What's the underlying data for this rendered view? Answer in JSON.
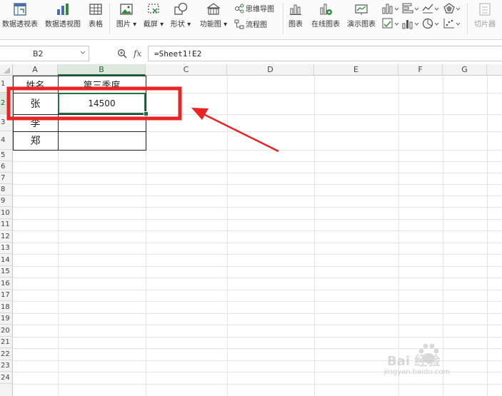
{
  "ribbon": {
    "buttons": [
      {
        "name": "pivot-table-button",
        "label": "数据透视表"
      },
      {
        "name": "pivot-chart-button",
        "label": "数据透视图"
      },
      {
        "name": "table-button",
        "label": "表格"
      },
      {
        "name": "picture-button",
        "label": "图片"
      },
      {
        "name": "screenshot-button",
        "label": "截屏"
      },
      {
        "name": "shapes-button",
        "label": "形状"
      },
      {
        "name": "function-chart-button",
        "label": "功能图"
      },
      {
        "name": "chart-button",
        "label": "图表"
      },
      {
        "name": "online-chart-button",
        "label": "在线图表"
      },
      {
        "name": "demo-chart-button",
        "label": "演示图表"
      },
      {
        "name": "slicer-button",
        "label": "切片器"
      }
    ],
    "mindmap_label": "思维导图",
    "flowchart_label": "流程图",
    "icons": [
      "pivot-table-icon",
      "pivot-chart-icon",
      "table-icon",
      "picture-icon",
      "screenshot-icon",
      "shapes-icon",
      "function-chart-icon",
      "mindmap-icon",
      "flowchart-icon",
      "chart-icon",
      "online-chart-icon",
      "demo-chart-icon",
      "bar-chart-icon",
      "bar-h-chart-icon",
      "line-chart-icon",
      "radar-chart-icon",
      "area-chart-icon",
      "column-chart-icon",
      "pie-chart-icon",
      "scatter-chart-icon",
      "slicer-icon"
    ]
  },
  "formula_bar": {
    "name_box": "B2",
    "fx_label": "fx",
    "formula": "=Sheet1!E2"
  },
  "columns": [
    "A",
    "B",
    "C",
    "D",
    "E",
    "F",
    "G"
  ],
  "selected_column": "B",
  "rows": [
    "1",
    "2",
    "3",
    "4",
    "5",
    "6",
    "7",
    "8",
    "9",
    "10",
    "11",
    "12",
    "13",
    "14",
    "15",
    "16",
    "17",
    "18",
    "19",
    "20",
    "21",
    "22",
    "23",
    "24"
  ],
  "selected_row": "2",
  "cells": {
    "A1": "姓名",
    "B1": "第三季度",
    "A2": "张",
    "B2": "14500",
    "A3": "李",
    "A4": "郑"
  },
  "annotation_color": "#e82424",
  "selection_color": "#217346",
  "watermark": {
    "brand": "Bai 经验",
    "url": "jingyan.baidu.com"
  }
}
